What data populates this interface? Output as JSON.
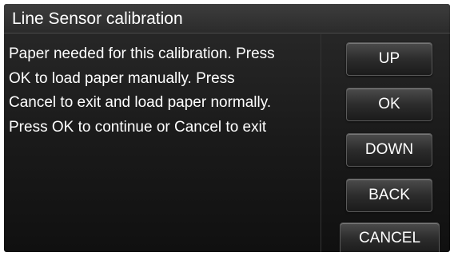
{
  "header": {
    "title": "Line Sensor calibration"
  },
  "message": {
    "lines": [
      "Paper needed for this calibration. Press",
      "OK to load paper manually. Press",
      "Cancel to exit and load paper normally.",
      "Press OK to continue or Cancel to exit"
    ]
  },
  "buttons": {
    "up": "UP",
    "ok": "OK",
    "down": "DOWN",
    "back": "BACK",
    "cancel": "CANCEL"
  }
}
